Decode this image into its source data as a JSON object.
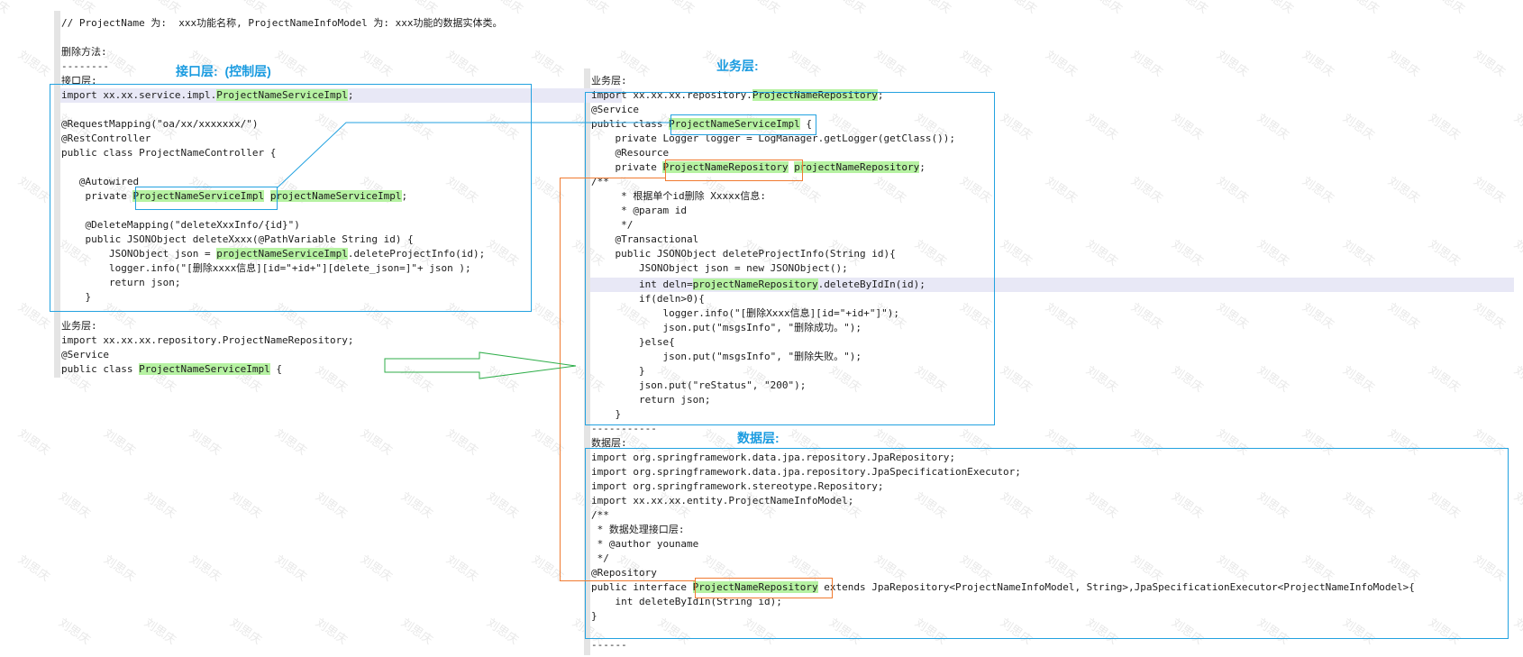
{
  "left": {
    "lines": [
      "// ProjectName 为:  xxx功能名称, ProjectNameInfoModel 为: xxx功能的数据实体类。",
      "删除方法:",
      "--------",
      "接口层:",
      "import xx.xx.service.impl.ProjectNameServiceImpl;",
      "@RequestMapping(\"oa/xx/xxxxxxx/\")",
      "@RestController",
      "public class ProjectNameController {",
      "   @Autowired",
      "    private ProjectNameServiceImpl projectNameServiceImpl;",
      "    @DeleteMapping(\"deleteXxxInfo/{id}\")",
      "    public JSONObject deleteXxxx(@PathVariable String id) {",
      "        JSONObject json = projectNameServiceImpl.deleteProjectInfo(id);",
      "        logger.info(\"[删除xxxx信息][id=\"+id+\"][delete_json=]\"+ json );",
      "        return json;",
      "    }",
      "业务层:",
      "import xx.xx.xx.repository.ProjectNameRepository;",
      "@Service",
      "public class ProjectNameServiceImpl {"
    ]
  },
  "right": {
    "lines": [
      "业务层:",
      "import xx.xx.xx.repository.ProjectNameRepository;",
      "@Service",
      "public class ProjectNameServiceImpl {",
      "    private Logger logger = LogManager.getLogger(getClass());",
      "    @Resource",
      "    private ProjectNameRepository projectNameRepository;",
      "/**",
      "     * 根据单个id删除 Xxxxx信息:",
      "     * @param id",
      "     */",
      "    @Transactional",
      "    public JSONObject deleteProjectInfo(String id){",
      "        JSONObject json = new JSONObject();",
      "        int deln=projectNameRepository.deleteByIdIn(id);",
      "        if(deln>0){",
      "            logger.info(\"[删除Xxxx信息][id=\"+id+\"]\");",
      "            json.put(\"msgsInfo\", \"删除成功。\");",
      "        }else{",
      "            json.put(\"msgsInfo\", \"删除失败。\");",
      "        }",
      "        json.put(\"reStatus\", \"200\");",
      "        return json;",
      "    }",
      "-----------",
      "数据层:",
      "import org.springframework.data.jpa.repository.JpaRepository;",
      "import org.springframework.data.jpa.repository.JpaSpecificationExecutor;",
      "import org.springframework.stereotype.Repository;",
      "import xx.xx.xx.entity.ProjectNameInfoModel;",
      "/**",
      " * 数据处理接口层:",
      " * @author youname",
      " */",
      "@Repository",
      "public interface ProjectNameRepository extends JpaRepository<ProjectNameInfoModel, String>,JpaSpecificationExecutor<ProjectNameInfoModel>{",
      "    int deleteByIdIn(String id);",
      "}",
      "------"
    ]
  },
  "titles": {
    "interface_layer": "接口层:  (控制层)",
    "business_layer": "业务层:",
    "data_layer": "数据层:"
  },
  "watermark": "刘思庆",
  "colors": {
    "highlight": "#b6f2a2",
    "box_blue": "#23a2e0",
    "box_orange": "#f07a30",
    "arrow_green": "#2fae4a",
    "title_blue": "#1a9be0"
  }
}
